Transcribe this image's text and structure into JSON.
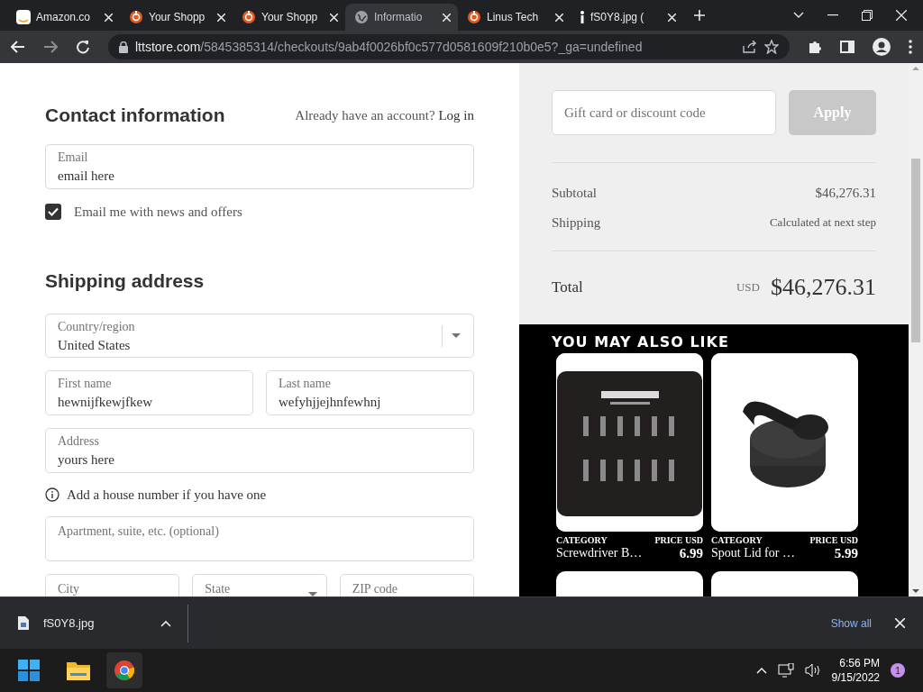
{
  "browser": {
    "tabs": [
      {
        "title": "Amazon.co",
        "kind": "amazon",
        "selected": false
      },
      {
        "title": "Your Shopp",
        "kind": "ltt",
        "selected": false
      },
      {
        "title": "Your Shopp",
        "kind": "ltt",
        "selected": false
      },
      {
        "title": "Informatio",
        "kind": "globe",
        "selected": true
      },
      {
        "title": "Linus Tech",
        "kind": "ltt",
        "selected": false
      },
      {
        "title": "fS0Y8.jpg (",
        "kind": "file",
        "selected": false
      }
    ],
    "url": {
      "domain": "lttstore.com",
      "path": "/5845385314/checkouts/9ab4f0026bf0c577d0581609f210b0e5?_ga=undefined"
    }
  },
  "contact": {
    "heading": "Contact information",
    "login_prompt": "Already have an account?",
    "login_link": "Log in",
    "email": {
      "label": "Email",
      "value": "email here"
    },
    "newsletter": {
      "label": "Email me with news and offers",
      "checked": true
    }
  },
  "shipping": {
    "heading": "Shipping address",
    "country": {
      "label": "Country/region",
      "value": "United States"
    },
    "first_name": {
      "label": "First name",
      "value": "hewnijfkewjfkew"
    },
    "last_name": {
      "label": "Last name",
      "value": "wefyhjjejhnfewhnj"
    },
    "address": {
      "label": "Address",
      "value": "yours here"
    },
    "hint": "Add a house number if you have one",
    "apartment": {
      "placeholder": "Apartment, suite, etc. (optional)"
    },
    "city": {
      "placeholder": "City"
    },
    "state": {
      "placeholder": "State"
    },
    "zip": {
      "placeholder": "ZIP code"
    }
  },
  "summary": {
    "discount": {
      "placeholder": "Gift card or discount code",
      "button": "Apply",
      "disabled": true
    },
    "rows": [
      {
        "label": "Subtotal",
        "value": "$46,276.31"
      },
      {
        "label": "Shipping",
        "value": "Calculated at next step"
      }
    ],
    "total": {
      "label": "Total",
      "currency": "USD",
      "value": "$46,276.31"
    }
  },
  "recommendations": {
    "heading": "YOU MAY ALSO LIKE",
    "products": [
      {
        "kind": "bitset",
        "category_label": "CATEGORY",
        "price_label": "PRICE USD",
        "name": "Screwdriver B…",
        "price": "6.99"
      },
      {
        "kind": "lid",
        "category_label": "CATEGORY",
        "price_label": "PRICE USD",
        "name": "Spout Lid for …",
        "price": "5.99"
      },
      {
        "kind": "cut"
      },
      {
        "kind": "cut"
      }
    ]
  },
  "downloads": {
    "file": "fS0Y8.jpg",
    "show_all": "Show all"
  },
  "taskbar": {
    "time": "6:56 PM",
    "date": "9/15/2022",
    "notifications": "1"
  }
}
